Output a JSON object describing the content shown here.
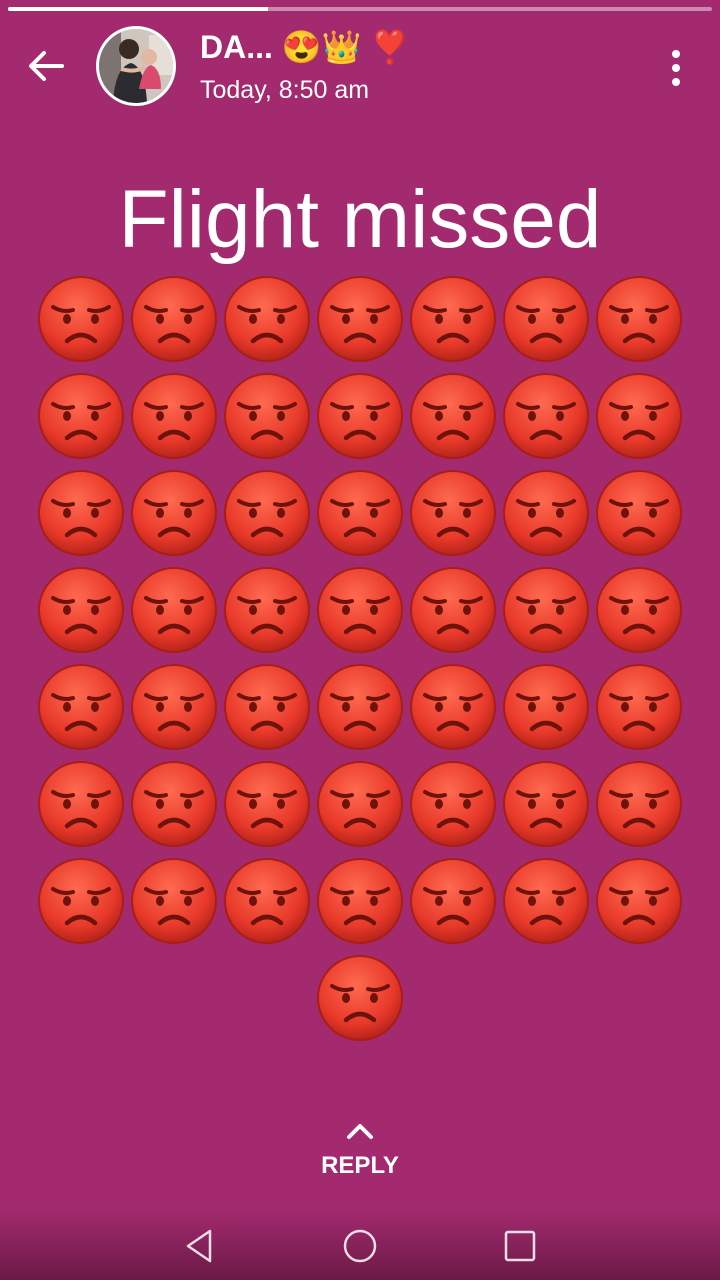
{
  "story": {
    "progress_fraction": 0.37
  },
  "header": {
    "name": "DA... 😍👑 ❣️",
    "timestamp": "Today, 8:50 am",
    "back_icon": "arrow-left-icon",
    "menu_icon": "more-vert-icon"
  },
  "post": {
    "caption": "Flight missed",
    "emoji": "pouting-face",
    "emoji_count": 50,
    "emoji_per_row": 7
  },
  "reply": {
    "label": "REPLY",
    "icon": "chevron-up-icon"
  },
  "system_nav": [
    "back-triangle-icon",
    "home-circle-icon",
    "recents-square-icon"
  ],
  "colors": {
    "background": "#a42a6f",
    "emoji_face": "#e8392a"
  }
}
